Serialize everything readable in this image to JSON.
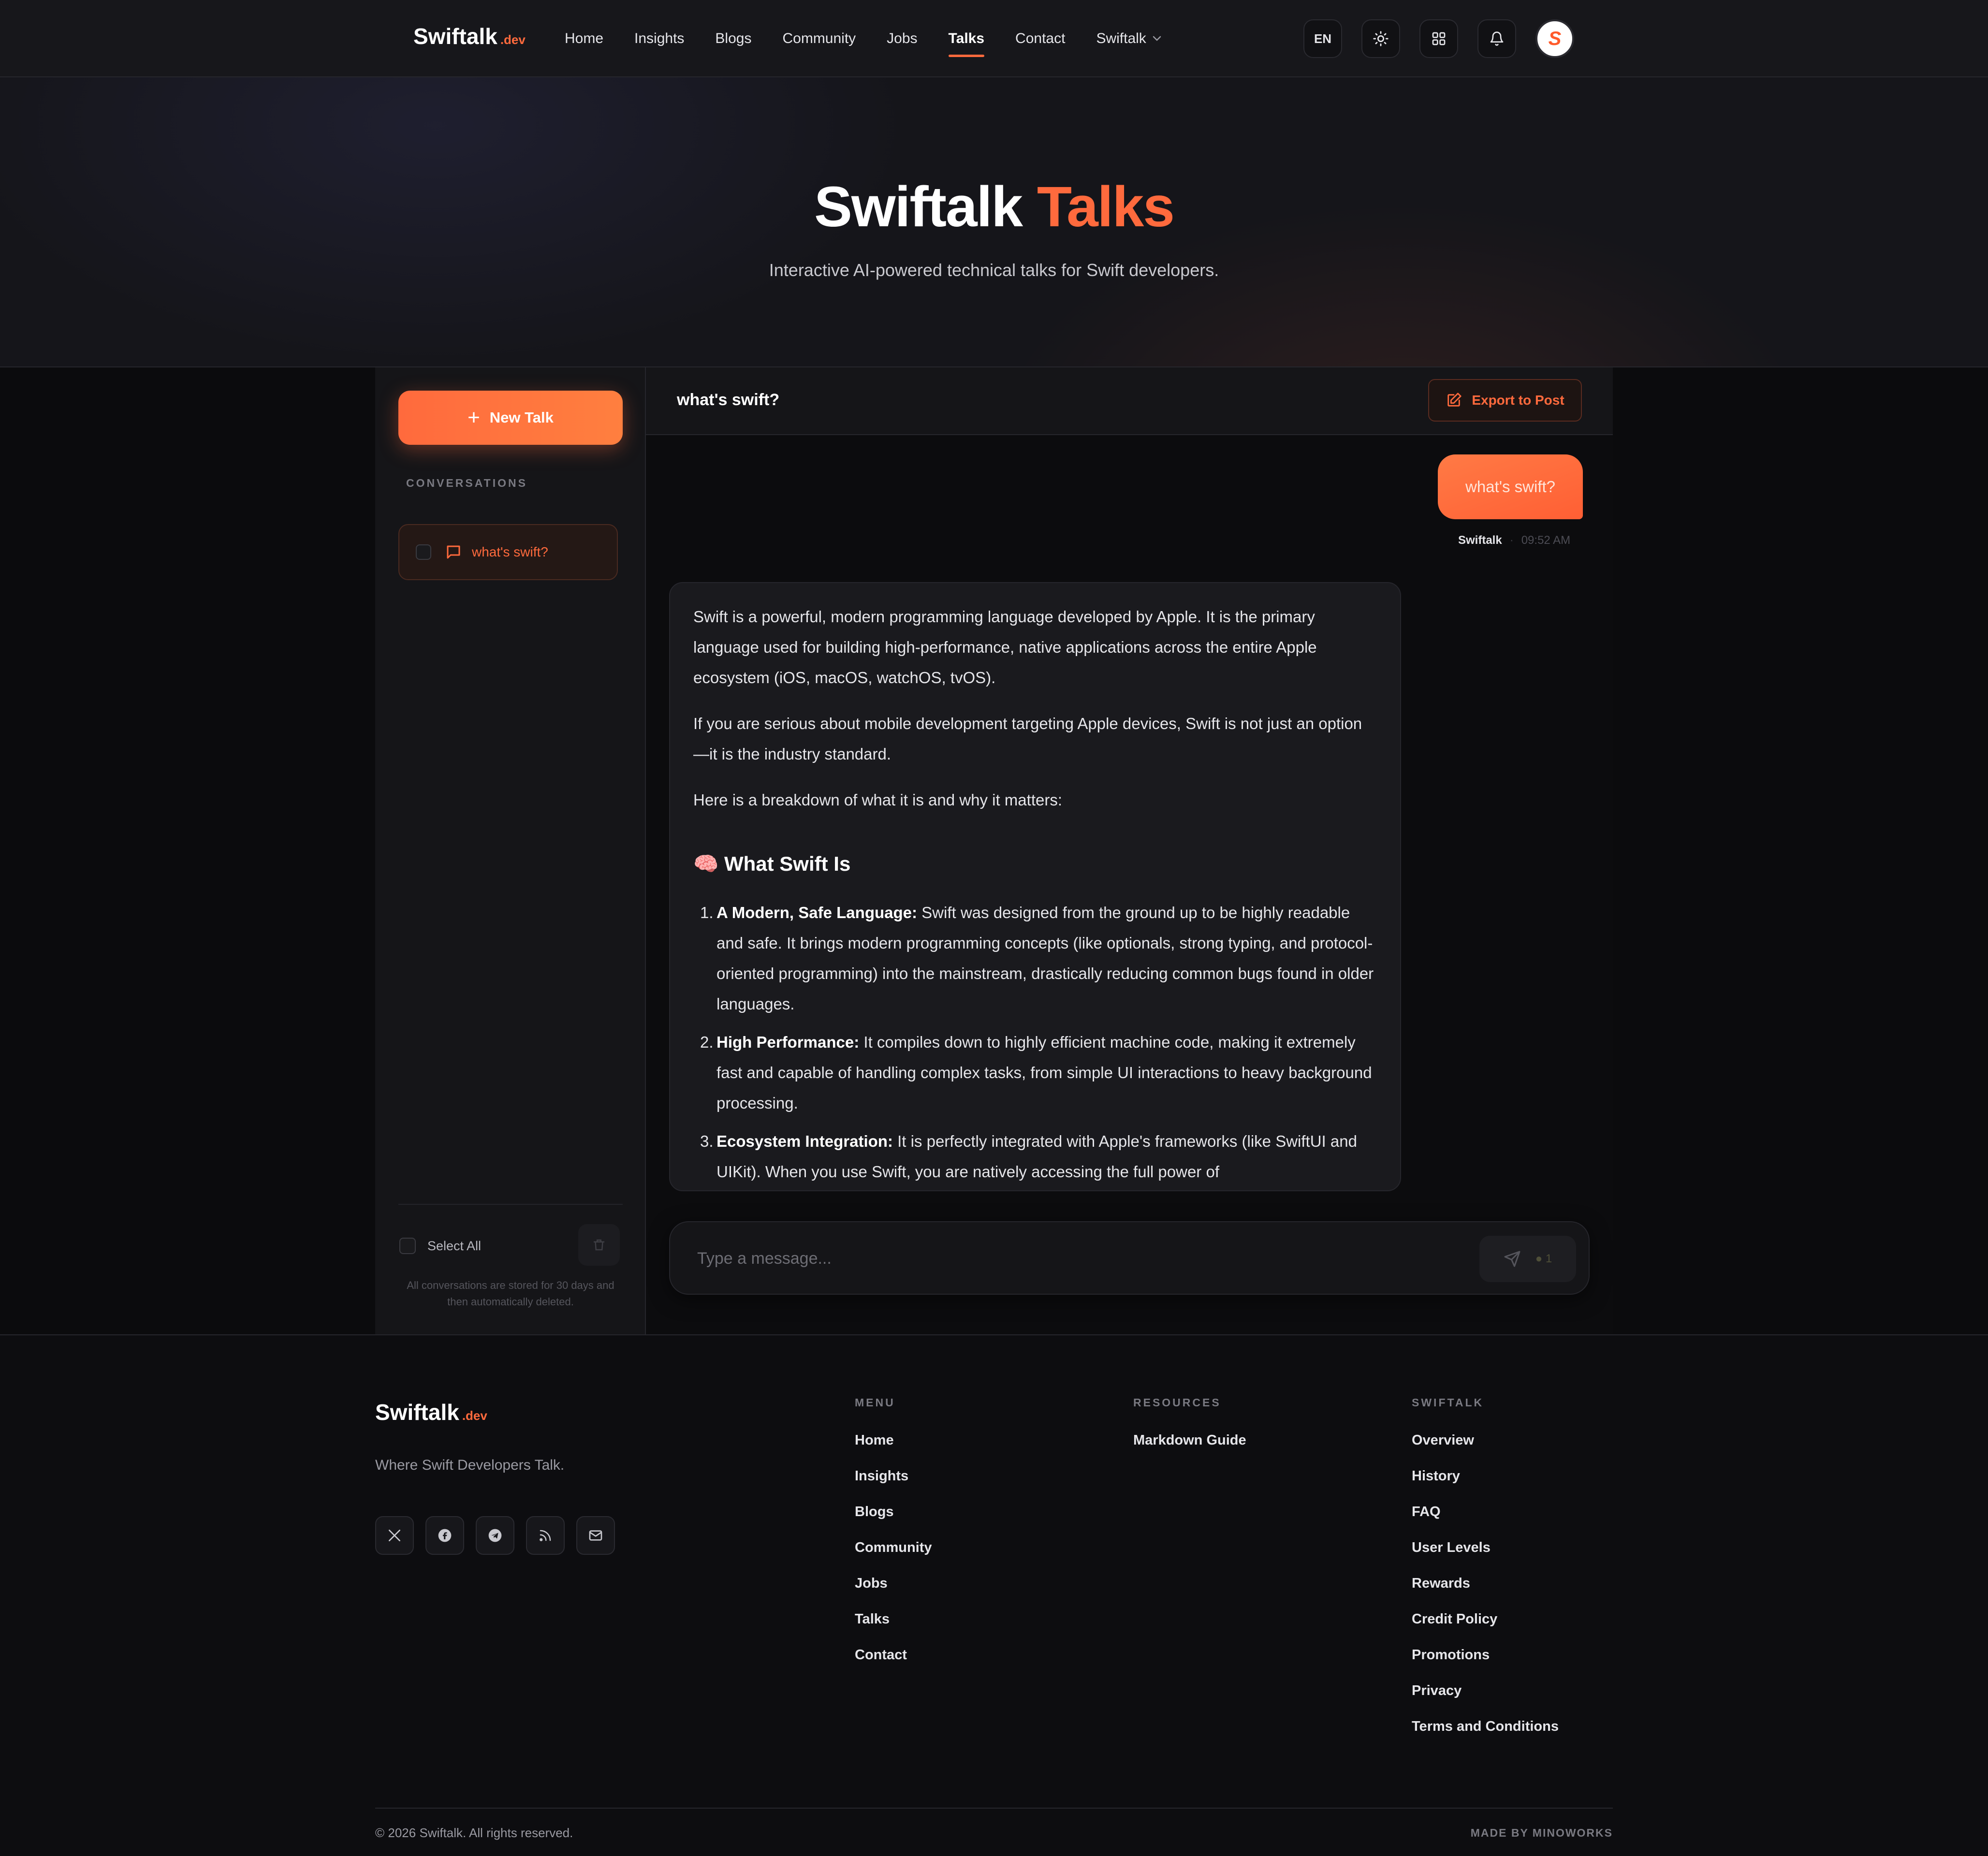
{
  "nav": {
    "brand_name": "Swiftalk",
    "brand_tld": ".dev",
    "links": [
      "Home",
      "Insights",
      "Blogs",
      "Community",
      "Jobs",
      "Talks",
      "Contact",
      "Swiftalk"
    ],
    "active_link": "Talks",
    "language": "EN",
    "avatar_letter": "S"
  },
  "hero": {
    "title_main": "Swiftalk",
    "title_accent": "Talks",
    "subtitle": "Interactive AI-powered technical talks for Swift developers."
  },
  "sidebar": {
    "new_talk_label": "New Talk",
    "conversations_heading": "CONVERSATIONS",
    "conversations": [
      {
        "title": "what's swift?",
        "active": true
      }
    ],
    "select_all_label": "Select All",
    "retention_note": "All conversations are stored for 30 days and then automatically deleted."
  },
  "chat": {
    "title": "what's swift?",
    "export_label": "Export to Post",
    "user_message": "what's swift?",
    "user_name": "Swiftalk",
    "user_time": "09:52 AM",
    "answer": {
      "p1": "Swift is a powerful, modern programming language developed by Apple. It is the primary language used for building high-performance, native applications across the entire Apple ecosystem (iOS, macOS, watchOS, tvOS).",
      "p2": "If you are serious about mobile development targeting Apple devices, Swift is not just an option—it is the industry standard.",
      "p3": "Here is a breakdown of what it is and why it matters:",
      "heading_emoji": "🧠",
      "heading": "What Swift Is",
      "items": [
        {
          "num": "1.",
          "title": "A Modern, Safe Language:",
          "text": "Swift was designed from the ground up to be highly readable and safe. It brings modern programming concepts (like optionals, strong typing, and protocol-oriented programming) into the mainstream, drastically reducing common bugs found in older languages."
        },
        {
          "num": "2.",
          "title": "High Performance:",
          "text": "It compiles down to highly efficient machine code, making it extremely fast and capable of handling complex tasks, from simple UI interactions to heavy background processing."
        },
        {
          "num": "3.",
          "title": "Ecosystem Integration:",
          "text": "It is perfectly integrated with Apple's frameworks (like SwiftUI and UIKit). When you use Swift, you are natively accessing the full power of"
        }
      ]
    },
    "input_placeholder": "Type a message...",
    "credit_cost": "1"
  },
  "footer": {
    "brand_name": "Swiftalk",
    "brand_tld": ".dev",
    "tagline": "Where Swift Developers Talk.",
    "socials": [
      "x-icon",
      "facebook-icon",
      "telegram-icon",
      "rss-icon",
      "mail-icon"
    ],
    "menu_heading": "MENU",
    "menu_links": [
      "Home",
      "Insights",
      "Blogs",
      "Community",
      "Jobs",
      "Talks",
      "Contact"
    ],
    "resources_heading": "RESOURCES",
    "resources_links": [
      "Markdown Guide"
    ],
    "swiftalk_heading": "SWIFTALK",
    "swiftalk_links": [
      "Overview",
      "History",
      "FAQ",
      "User Levels",
      "Rewards",
      "Credit Policy",
      "Promotions",
      "Privacy",
      "Terms and Conditions"
    ],
    "copyright": "© 2026 Swiftalk. All rights reserved.",
    "made_by": "MADE BY MINOWORKS"
  },
  "colors": {
    "accent": "#ff6a3d",
    "background": "#0b0b0d",
    "surface": "#151518"
  }
}
